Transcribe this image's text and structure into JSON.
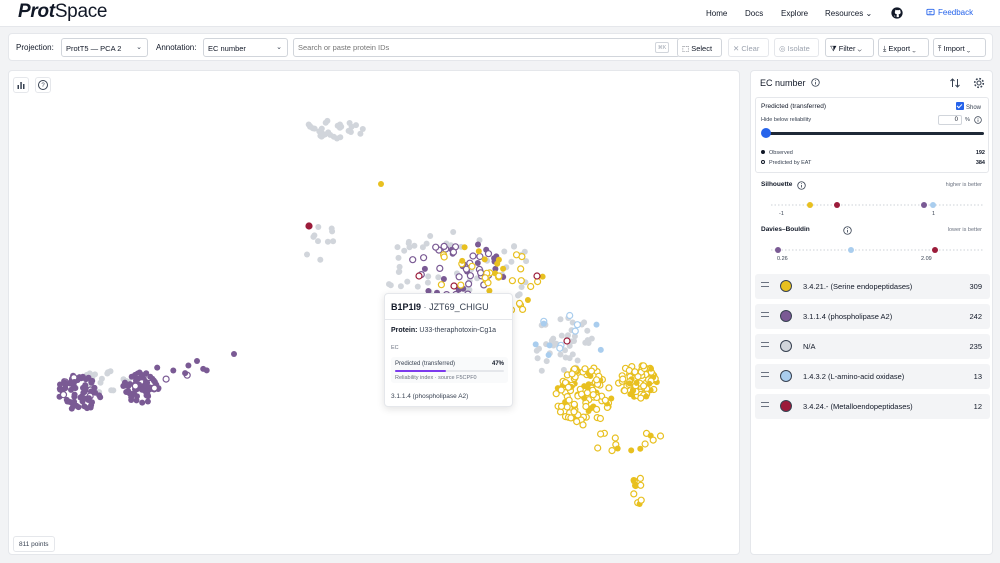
{
  "brand": {
    "name_bold": "Prot",
    "name_light": "Space"
  },
  "nav": {
    "links": [
      "Home",
      "Docs",
      "Explore",
      "Resources"
    ],
    "feedback": "Feedback"
  },
  "toolbar": {
    "projection_label": "Projection:",
    "projection_value": "ProtT5 — PCA 2",
    "annotation_label": "Annotation:",
    "annotation_value": "EC number",
    "search_placeholder": "Search or paste protein IDs",
    "buttons": {
      "select": "Select",
      "clear": "Clear",
      "isolate": "Isolate",
      "filter": "Filter",
      "export": "Export",
      "import": "Import"
    }
  },
  "plot": {
    "point_count": "811 points",
    "tooltip": {
      "accession": "B1P1I9",
      "separator": "·",
      "entry_name": "JZT69_CHIGU",
      "protein_label": "Protein:",
      "protein_value": "U33-theraphotoxin-Cg1a",
      "section_label": "EC",
      "pred_label": "Predicted (transferred)",
      "pred_pct": "47%",
      "pred_value": 0.47,
      "reliability": "Reliability index · source F5CPF0",
      "ec_value": "3.1.1.4 (phospholipase A2)"
    }
  },
  "side": {
    "title": "EC number",
    "pred_title": "Predicted (transferred)",
    "show_label": "Show",
    "hide_label": "Hide below reliability",
    "hide_value": "0",
    "hide_unit": "%",
    "observed_label": "Observed",
    "observed_count": "192",
    "predicted_label": "Predicted by EAT",
    "predicted_count": "384",
    "silhouette": {
      "title": "Silhouette",
      "hint": "higher is better",
      "min": "-1",
      "max": "1"
    },
    "davies": {
      "title": "Davies–Bouldin",
      "hint": "lower is better",
      "min": "0.26",
      "max": "2.09"
    },
    "categories": [
      {
        "label": "3.4.21.- (Serine endopeptidases)",
        "count": "309",
        "color": "#e8c020"
      },
      {
        "label": "3.1.1.4 (phospholipase A2)",
        "count": "242",
        "color": "#7a5a94"
      },
      {
        "label": "N/A",
        "count": "235",
        "color": "#d1d5db"
      },
      {
        "label": "1.4.3.2 (L-amino-acid oxidase)",
        "count": "13",
        "color": "#a9cdee"
      },
      {
        "label": "3.4.24.- (Metalloendopeptidases)",
        "count": "12",
        "color": "#9b1c3a"
      }
    ]
  }
}
